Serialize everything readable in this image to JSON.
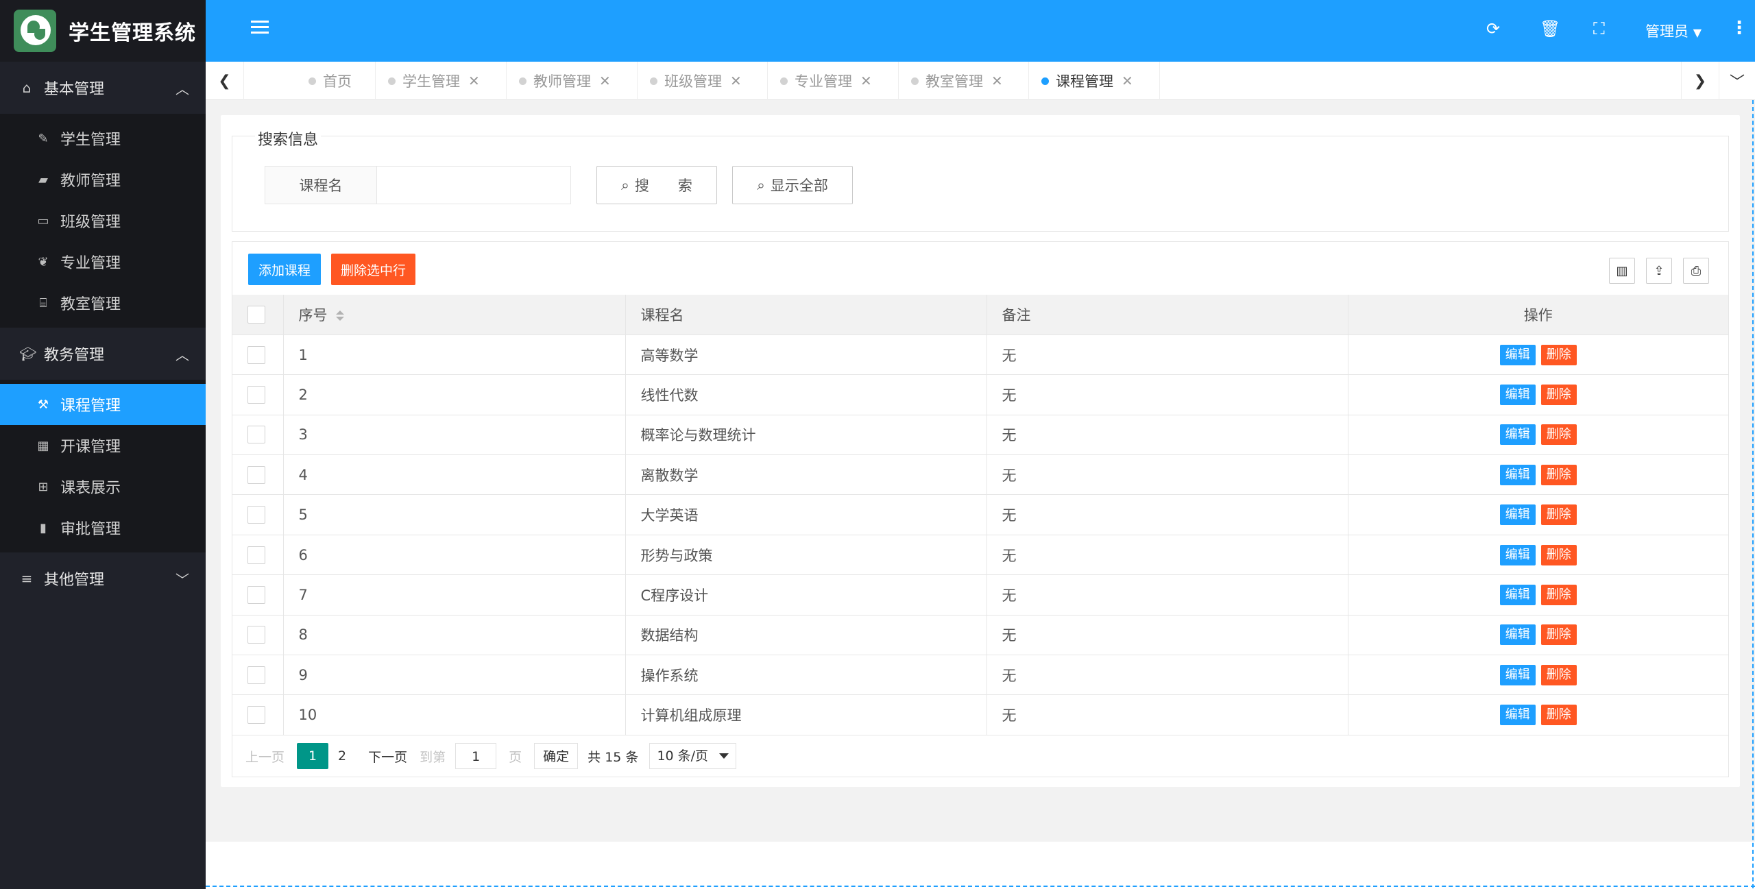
{
  "app": {
    "title": "学生管理系统"
  },
  "sidebar": {
    "groups": [
      {
        "label": "基本管理",
        "icon": "home-icon",
        "expanded": true,
        "items": [
          {
            "label": "学生管理",
            "icon": "pencil-icon"
          },
          {
            "label": "教师管理",
            "icon": "briefcase-icon"
          },
          {
            "label": "班级管理",
            "icon": "window-icon"
          },
          {
            "label": "专业管理",
            "icon": "leaf-icon"
          },
          {
            "label": "教室管理",
            "icon": "bank-icon"
          }
        ]
      },
      {
        "label": "教务管理",
        "icon": "graduation-cap-icon",
        "expanded": true,
        "items": [
          {
            "label": "课程管理",
            "icon": "gavel-icon",
            "active": true
          },
          {
            "label": "开课管理",
            "icon": "calendar-icon"
          },
          {
            "label": "课表展示",
            "icon": "table-icon"
          },
          {
            "label": "审批管理",
            "icon": "book-icon"
          }
        ]
      },
      {
        "label": "其他管理",
        "icon": "list-icon",
        "expanded": false,
        "items": []
      }
    ]
  },
  "topbar": {
    "user_label": "管理员",
    "icons": [
      "refresh-icon",
      "trash-icon",
      "fullscreen-icon",
      "more-vertical-icon"
    ],
    "accent": "#1e9fff"
  },
  "tabs": [
    {
      "label": "首页",
      "closable": false,
      "active": false
    },
    {
      "label": "学生管理",
      "closable": true,
      "active": false
    },
    {
      "label": "教师管理",
      "closable": true,
      "active": false
    },
    {
      "label": "班级管理",
      "closable": true,
      "active": false
    },
    {
      "label": "专业管理",
      "closable": true,
      "active": false
    },
    {
      "label": "教室管理",
      "closable": true,
      "active": false
    },
    {
      "label": "课程管理",
      "closable": true,
      "active": true
    }
  ],
  "search": {
    "legend": "搜索信息",
    "field_label": "课程名",
    "field_value": "",
    "search_button": "搜　　索",
    "show_all_button": "显示全部"
  },
  "toolbar": {
    "add_button": "添加课程",
    "delete_selected_button": "删除选中行",
    "add_color": "#1e9fff",
    "delete_color": "#ff5722",
    "tool_icons": [
      "columns-icon",
      "export-icon",
      "print-icon"
    ]
  },
  "table": {
    "columns": [
      "序号",
      "课程名",
      "备注",
      "操作"
    ],
    "edit_label": "编辑",
    "delete_label": "删除",
    "rows": [
      {
        "id": "1",
        "name": "高等数学",
        "note": "无"
      },
      {
        "id": "2",
        "name": "线性代数",
        "note": "无"
      },
      {
        "id": "3",
        "name": "概率论与数理统计",
        "note": "无"
      },
      {
        "id": "4",
        "name": "离散数学",
        "note": "无"
      },
      {
        "id": "5",
        "name": "大学英语",
        "note": "无"
      },
      {
        "id": "6",
        "name": "形势与政策",
        "note": "无"
      },
      {
        "id": "7",
        "name": "C程序设计",
        "note": "无"
      },
      {
        "id": "8",
        "name": "数据结构",
        "note": "无"
      },
      {
        "id": "9",
        "name": "操作系统",
        "note": "无"
      },
      {
        "id": "10",
        "name": "计算机组成原理",
        "note": "无"
      }
    ]
  },
  "pager": {
    "prev": "上一页",
    "current": "1",
    "page2": "2",
    "next": "下一页",
    "goto_prefix": "到第",
    "goto_value": "1",
    "goto_suffix": "页",
    "confirm": "确定",
    "total": "共 15 条",
    "page_size": "10 条/页",
    "current_color": "#009688"
  }
}
